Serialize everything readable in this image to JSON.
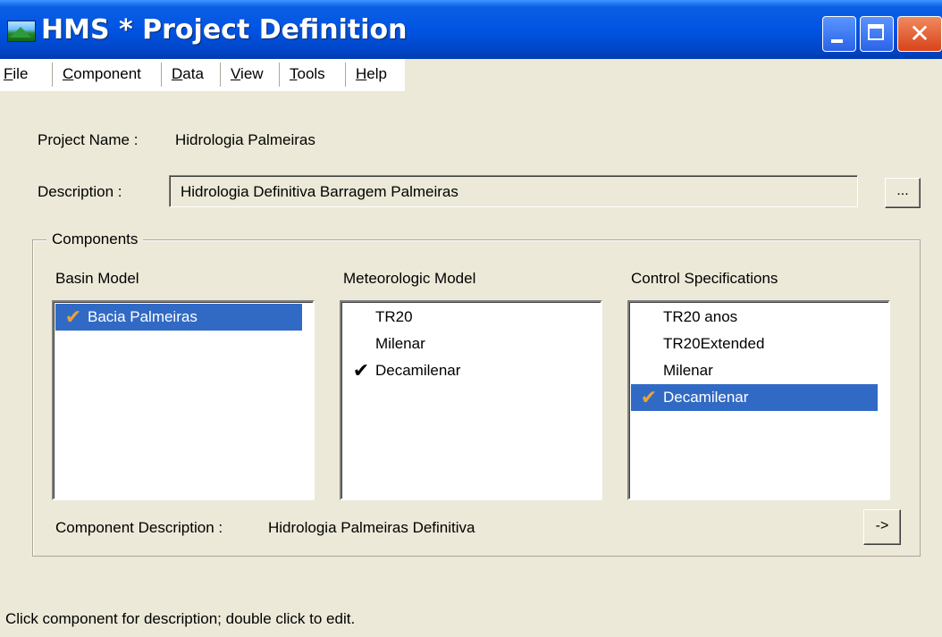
{
  "window": {
    "title": "HMS * Project Definition",
    "icon": "app-landscape-icon",
    "controls": {
      "close_glyph": "✕"
    }
  },
  "menu": {
    "items": [
      {
        "label": "File",
        "underline": "F",
        "rest": "ile"
      },
      {
        "label": "Component",
        "underline": "C",
        "rest": "omponent"
      },
      {
        "label": "Data",
        "underline": "D",
        "rest": "ata"
      },
      {
        "label": "View",
        "underline": "V",
        "rest": "iew"
      },
      {
        "label": "Tools",
        "underline": "T",
        "rest": "ools"
      },
      {
        "label": "Help",
        "underline": "H",
        "rest": "elp"
      }
    ]
  },
  "project": {
    "name_label": "Project Name :",
    "name_value": "Hidrologia Palmeiras",
    "description_label": "Description :",
    "description_value": "Hidrologia Definitiva Barragem Palmeiras",
    "browse_label": "..."
  },
  "components": {
    "group_label": "Components",
    "basin": {
      "header": "Basin Model",
      "items": [
        {
          "label": "Bacia Palmeiras",
          "check": "✔"
        }
      ]
    },
    "meteorologic": {
      "header": "Meteorologic Model",
      "items": [
        {
          "label": "TR20",
          "check": ""
        },
        {
          "label": "Milenar",
          "check": ""
        },
        {
          "label": "Decamilenar",
          "check": "✔"
        }
      ]
    },
    "control": {
      "header": "Control Specifications",
      "items": [
        {
          "label": "TR20 anos",
          "check": ""
        },
        {
          "label": "TR20Extended",
          "check": ""
        },
        {
          "label": "Milenar",
          "check": ""
        },
        {
          "label": "Decamilenar",
          "check": "✔"
        }
      ]
    },
    "description_label": "Component Description :",
    "description_value": "Hidrologia Palmeiras Definitiva",
    "edit_button_label": "->"
  },
  "status": {
    "text": "Click component for description; double click to edit."
  },
  "colors": {
    "titlebar": "#0054E3",
    "selection": "#316AC5",
    "checkmark_selected": "#E8A33A",
    "window_bg": "#ECE9D8"
  }
}
